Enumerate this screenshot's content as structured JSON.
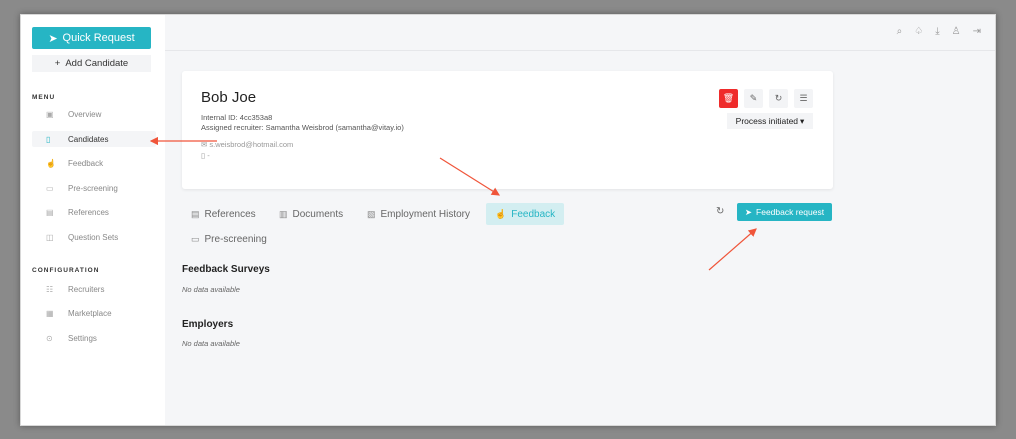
{
  "sidebar": {
    "quick_request_label": "Quick Request",
    "add_candidate_label": "Add Candidate",
    "menu_heading": "MENU",
    "menu_items": [
      {
        "label": "Overview",
        "icon": "overview-icon",
        "glyph": "▣"
      },
      {
        "label": "Candidates",
        "icon": "candidates-icon",
        "glyph": "▯",
        "active": true
      },
      {
        "label": "Feedback",
        "icon": "thumb-up-icon",
        "glyph": "☝"
      },
      {
        "label": "Pre-screening",
        "icon": "video-icon",
        "glyph": "▭"
      },
      {
        "label": "References",
        "icon": "reference-icon",
        "glyph": "▤"
      },
      {
        "label": "Question Sets",
        "icon": "chat-icon",
        "glyph": "◫"
      }
    ],
    "config_heading": "CONFIGURATION",
    "config_items": [
      {
        "label": "Recruiters",
        "icon": "users-icon",
        "glyph": "☷"
      },
      {
        "label": "Marketplace",
        "icon": "store-icon",
        "glyph": "▦"
      },
      {
        "label": "Settings",
        "icon": "gear-icon",
        "glyph": "⊙"
      }
    ]
  },
  "topbar": {
    "icons": [
      "search-icon",
      "bell-icon",
      "download-icon",
      "user-icon",
      "logout-icon"
    ]
  },
  "candidate": {
    "name": "Bob Joe",
    "internal_id": "Internal ID: 4cc353a8",
    "assigned_recruiter": "Assigned recruiter: Samantha Weisbrod (samantha@vitay.io)",
    "email": "s.weisbrod@hotmail.com",
    "phone": "-",
    "status": "Process initiated"
  },
  "tabs": [
    {
      "label": "References",
      "icon": "reference-icon",
      "glyph": "▤"
    },
    {
      "label": "Documents",
      "icon": "documents-icon",
      "glyph": "▥"
    },
    {
      "label": "Employment History",
      "icon": "briefcase-icon",
      "glyph": "▧"
    },
    {
      "label": "Feedback",
      "icon": "thumb-up-icon",
      "glyph": "☝",
      "active": true
    },
    {
      "label": "Pre-screening",
      "icon": "video-icon",
      "glyph": "▭"
    }
  ],
  "feedback_request_label": "Feedback request",
  "sections": {
    "feedback_surveys_title": "Feedback Surveys",
    "feedback_surveys_empty": "No data available",
    "employers_title": "Employers",
    "employers_empty": "No data available"
  },
  "colors": {
    "accent": "#26b5c4",
    "delete": "#ef2b2b",
    "annotation_arrow": "#f0553a"
  }
}
